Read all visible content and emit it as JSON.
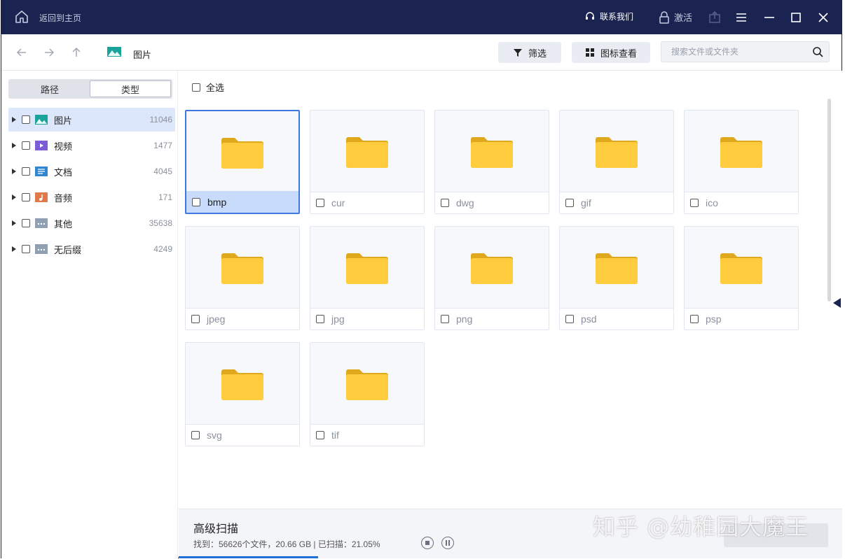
{
  "titlebar": {
    "back_home": "返回到主页",
    "contact": "联系我们",
    "activate": "激活"
  },
  "toolbar": {
    "crumb": "图片",
    "filter_label": "筛选",
    "view_label": "图标查看",
    "search_placeholder": "搜索文件或文件夹"
  },
  "sidebar": {
    "tabs": [
      "路径",
      "类型"
    ],
    "active_tab": "类型",
    "items": [
      {
        "label": "图片",
        "count": "11046",
        "icon": "image-type-icon",
        "color": "#1aa39a"
      },
      {
        "label": "视频",
        "count": "1477",
        "icon": "video-type-icon",
        "color": "#7b5cd6"
      },
      {
        "label": "文档",
        "count": "4045",
        "icon": "document-type-icon",
        "color": "#2f86d1"
      },
      {
        "label": "音频",
        "count": "171",
        "icon": "audio-type-icon",
        "color": "#e07a4a"
      },
      {
        "label": "其他",
        "count": "35638",
        "icon": "other-type-icon",
        "color": "#8fa0b3"
      },
      {
        "label": "无后缀",
        "count": "4249",
        "icon": "no-extension-type-icon",
        "color": "#8fa0b3"
      }
    ]
  },
  "main": {
    "select_all": "全选",
    "folders": [
      "bmp",
      "cur",
      "dwg",
      "gif",
      "ico",
      "jpeg",
      "jpg",
      "png",
      "psd",
      "psp",
      "svg",
      "tif"
    ],
    "selected_folder": "bmp"
  },
  "status": {
    "title": "高级扫描",
    "found_label": "找到：56626个文件，20.66 GB | 已扫描：21.05%",
    "scanned_fraction": 0.2105
  },
  "watermark": "知乎 @幼稚园大魔王"
}
